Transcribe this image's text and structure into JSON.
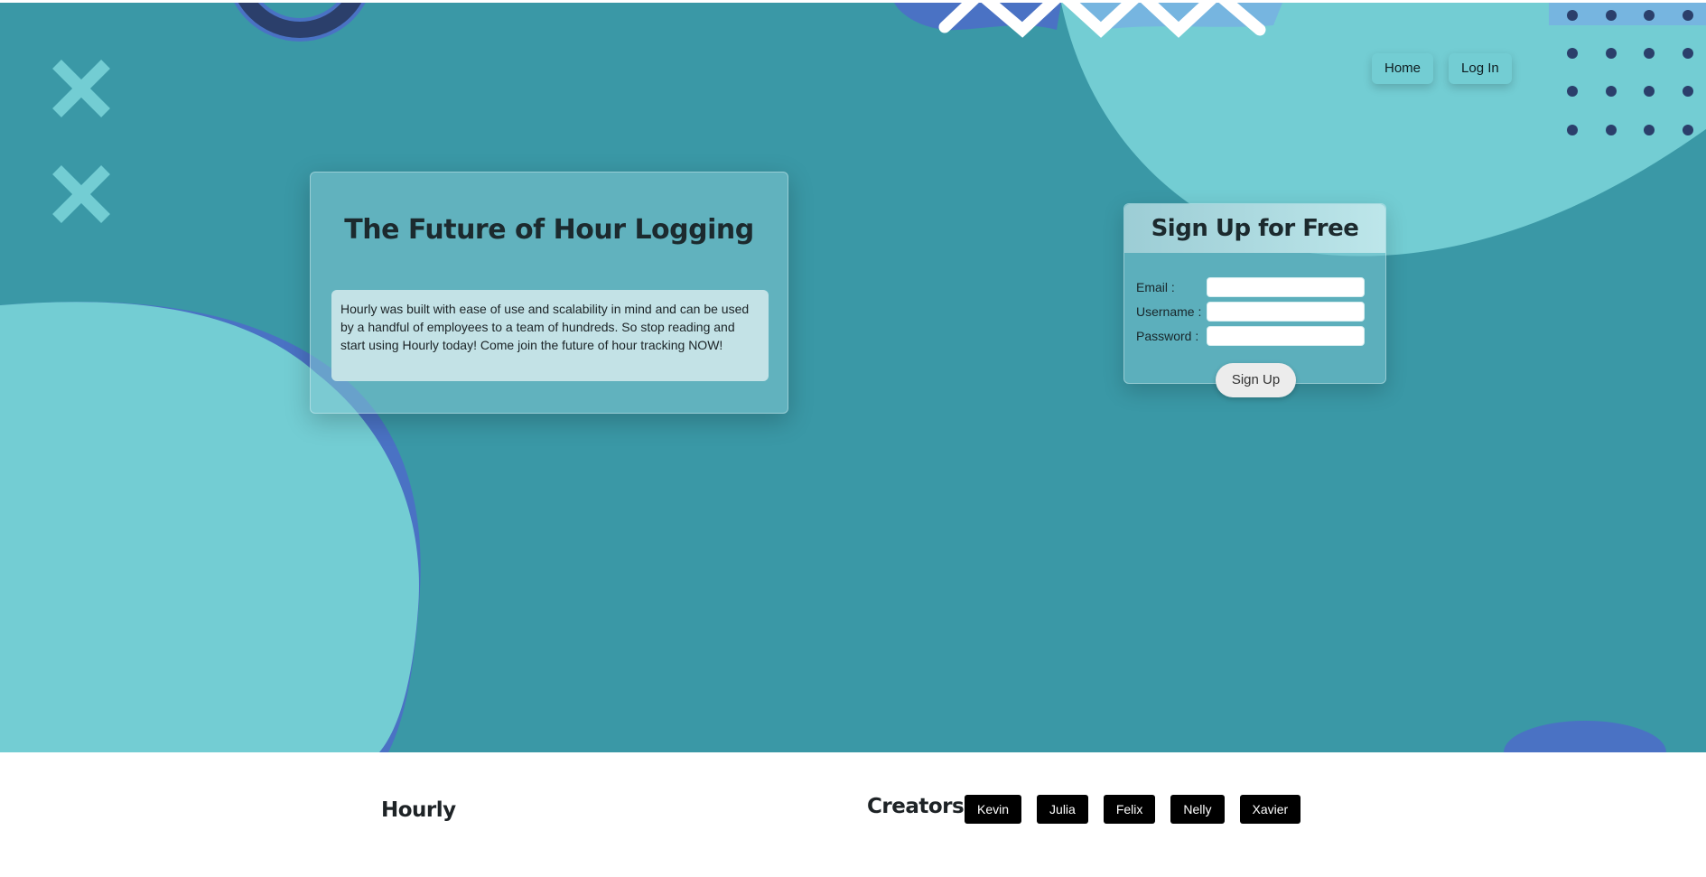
{
  "nav": {
    "home_label": "Home",
    "login_label": "Log In"
  },
  "intro": {
    "title": "The Future of Hour Logging",
    "text": "Hourly was built with ease of use and scalability in mind and can be used by a handful of employees to a team of hundreds. So stop reading and start using Hourly today! Come join the future of hour tracking NOW!"
  },
  "signup": {
    "title": "Sign Up for Free",
    "email_label": "Email :",
    "username_label": "Username :",
    "password_label": "Password :",
    "email_value": "",
    "username_value": "",
    "password_value": "",
    "button_label": "Sign Up"
  },
  "footer": {
    "brand": "Hourly",
    "creators_label": "Creators :",
    "creators": [
      "Kevin",
      "Julia",
      "Felix",
      "Nelly",
      "Xavier"
    ]
  },
  "colors": {
    "background": "#3a98a6",
    "blob": "#73cdd3",
    "accent_dark": "#2b3f6b",
    "accent_blue": "#4a72c4"
  }
}
